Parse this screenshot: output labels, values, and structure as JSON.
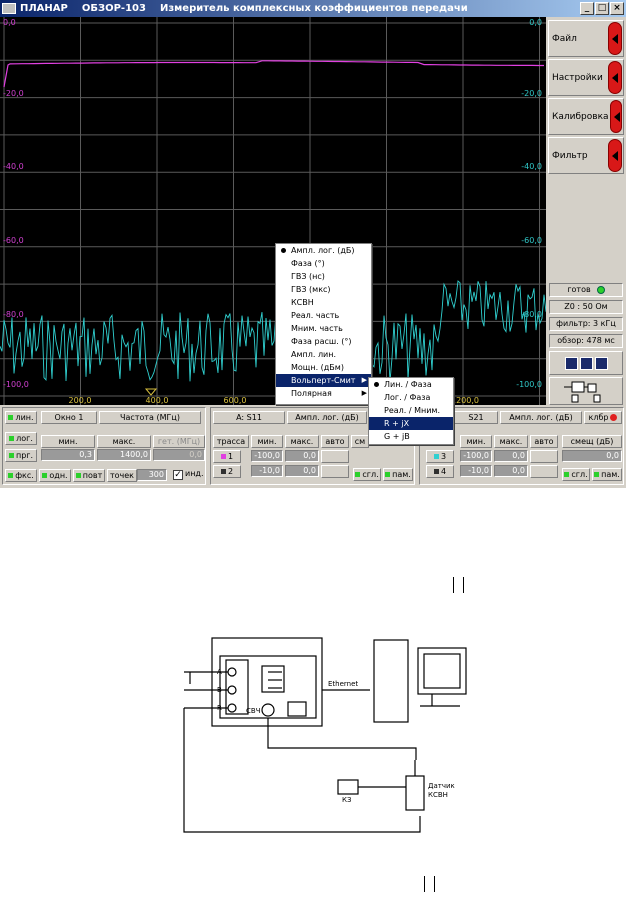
{
  "titlebar": {
    "app": "ПЛАНАР",
    "model": "ОБЗОР-103",
    "title": "Измеритель комплексных коэффициентов передачи"
  },
  "window_buttons": [
    "_",
    "□",
    "×"
  ],
  "plot": {
    "left_ticks": [
      "0,0",
      "-20,0",
      "-40,0",
      "-60,0",
      "-80,0",
      "-100,0"
    ],
    "right_ticks": [
      "0,0",
      "-20,0",
      "-40,0",
      "-60,0",
      "-80,0",
      "-100,0"
    ],
    "x_ticks": [
      "200,0",
      "400,0",
      "600,0",
      "1200,0"
    ],
    "colors": {
      "background": "#000000",
      "grid": "#5a5a5a",
      "trace_magenta": "#e040e0",
      "trace_cyan": "#30d0d0",
      "left_axis": "#d040d0",
      "right_axis": "#30c8c8",
      "x_axis": "#d8c040"
    }
  },
  "sidebar": {
    "buttons": [
      "Файл",
      "Настройки",
      "Калибровка",
      "Фильтр"
    ],
    "status": "готов",
    "z0": "Z0 : 50  Ом",
    "filter": "фильтр: 3 кГц",
    "sweep": "обзор: 478 мс"
  },
  "context_menu": {
    "items": [
      "Ампл. лог. (дБ)",
      "Фаза  (°)",
      "ГВЗ  (нс)",
      "ГВЗ  (мкс)",
      "КСВН",
      "Реал. часть",
      "Мним. часть",
      "Фаза расш.  (°)",
      "Ампл. лин.",
      "Мощн.  (дБм)",
      "Вольперт-Смит",
      "Полярная"
    ],
    "submenu": [
      "Лин. / Фаза",
      "Лог. / Фаза",
      "Реал. / Мним.",
      "R + jX",
      "G + jB"
    ]
  },
  "scale_panel": {
    "buttons": [
      "лин.",
      "лог.",
      "прг."
    ],
    "window": "Окно 1",
    "freq_label": "Частота (МГц)",
    "col_min": "мин.",
    "col_max": "макс.",
    "col_step": "гет. (МГц)",
    "min_val": "0,3",
    "max_val": "1400,0",
    "step_val": "0,0"
  },
  "sweep_row": {
    "fks": "фкс.",
    "odn": "одн.",
    "povt": "повт",
    "points_label": "точек",
    "points": "300",
    "ind_label": "инд."
  },
  "trace_panel_a": {
    "name": "A: S11",
    "format": "Ампл. лог. (дБ)",
    "col_trace": "трасса",
    "col_min": "мин.",
    "col_max": "макс.",
    "col_auto": "авто",
    "col_offset": "см",
    "rows": [
      {
        "n": "1",
        "min": "-100,0",
        "max": "0,0"
      },
      {
        "n": "2",
        "min": "-10,0",
        "max": "0,0"
      }
    ],
    "sgl": "сгл.",
    "pam": "пам."
  },
  "trace_panel_b": {
    "name": "S21",
    "format": "Ампл. лог. (дБ)",
    "calib": "клбр",
    "col_min": "мин.",
    "col_max": "макс.",
    "col_auto": "авто",
    "col_offset": "смещ  (дБ)",
    "offset_val": "0,0",
    "rows": [
      {
        "n": "3",
        "min": "-100,0",
        "max": "0,0"
      },
      {
        "n": "4",
        "min": "-10,0",
        "max": "0,0"
      }
    ],
    "sgl": "сгл.",
    "pam": "пам."
  },
  "diagram": {
    "ports": [
      "A",
      "B",
      "R"
    ],
    "svch": "СВЧ",
    "ethernet": "Ethernet",
    "kz": "КЗ",
    "sensor": [
      "Датчик",
      "КСВН"
    ]
  }
}
